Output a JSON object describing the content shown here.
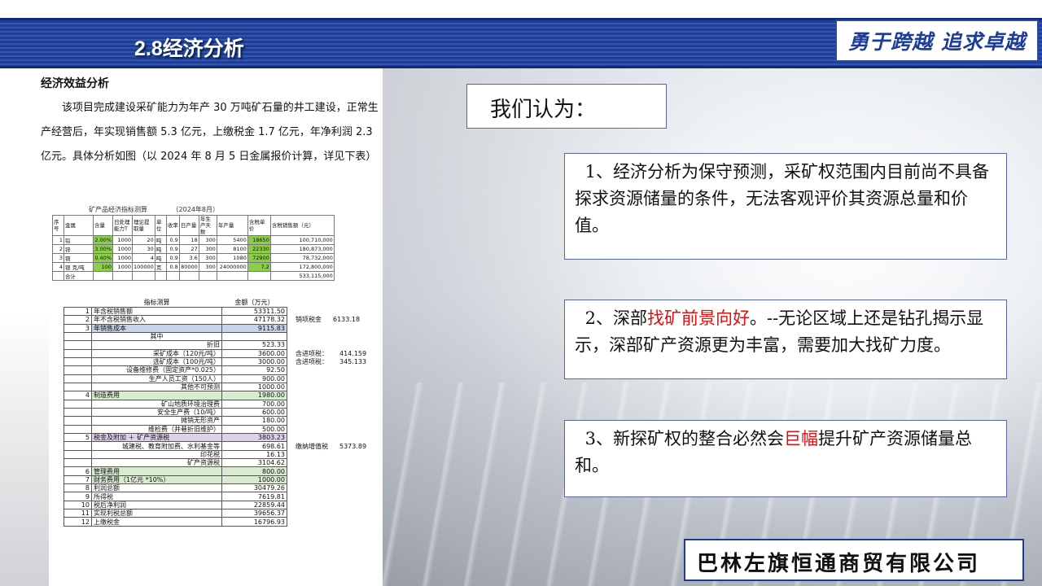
{
  "header": {
    "title": "2.8经济分析",
    "slogan": "勇于跨越  追求卓越"
  },
  "left": {
    "section_title": "经济效益分析",
    "paragraph": "该项目完成建设采矿能力为年产 30 万吨矿石量的井工建设，正常生产经营后，年实现销售额 5.3 亿元，上缴税金 1.7 亿元，年净利润 2.3 亿元。具体分析如图（以 2024 年 8 月 5 日金属报价计算，详见下表）"
  },
  "table1": {
    "caption": "矿产品经济指标测算",
    "date": "（2024年8月）",
    "headers": [
      "序号",
      "金属",
      "含量",
      "日处理能力T",
      "理论提取量",
      "单位",
      "收率",
      "日产量",
      "年生产天数",
      "年产量",
      "含税单价",
      "含税销售额（元）"
    ],
    "rows": [
      [
        "1",
        "铅",
        "2.00%",
        "1000",
        "20",
        "吨",
        "0.9",
        "18",
        "300",
        "5400",
        "18650",
        "100,710,000"
      ],
      [
        "2",
        "锌",
        "3.00%",
        "1000",
        "30",
        "吨",
        "0.9",
        "27",
        "300",
        "8100",
        "22330",
        "180,873,000"
      ],
      [
        "3",
        "铜",
        "0.40%",
        "1000",
        "4",
        "吨",
        "0.9",
        "3.6",
        "300",
        "1080",
        "72900",
        "78,732,000"
      ],
      [
        "4",
        "银 克/吨",
        "100",
        "1000",
        "100000",
        "克",
        "0.8",
        "80000",
        "300",
        "24000000",
        "7.2",
        "172,800,000"
      ]
    ],
    "total_label": "合计",
    "total_value": "533,115,000"
  },
  "table2": {
    "header_item": "指标测算",
    "header_amount": "金额（万元）",
    "rows": [
      {
        "no": "1",
        "item": "年含税销售额",
        "amount": "53311.50",
        "style": "",
        "align": "left",
        "ext_label": "",
        "ext_value": ""
      },
      {
        "no": "2",
        "item": "年不含税销售收入",
        "amount": "47178.32",
        "style": "",
        "align": "left",
        "ext_label": "销项税金",
        "ext_value": "6133.18"
      },
      {
        "no": "3",
        "item": "年销售成本",
        "amount": "9115.83",
        "style": "blue",
        "align": "left",
        "ext_label": "",
        "ext_value": ""
      },
      {
        "no": "",
        "item": "其中",
        "amount": "",
        "style": "",
        "align": "center",
        "ext_label": "",
        "ext_value": ""
      },
      {
        "no": "",
        "item": "折旧",
        "amount": "523.33",
        "style": "",
        "align": "right",
        "ext_label": "",
        "ext_value": ""
      },
      {
        "no": "",
        "item": "采矿成本（120元/吨）",
        "amount": "3600.00",
        "style": "",
        "align": "right",
        "ext_label": "含进项税：",
        "ext_value": "414.159"
      },
      {
        "no": "",
        "item": "选矿成本（100元/吨）",
        "amount": "3000.00",
        "style": "",
        "align": "right",
        "ext_label": "含进项税：",
        "ext_value": "345.133"
      },
      {
        "no": "",
        "item": "设备维修费（固定资产*0.025）",
        "amount": "92.50",
        "style": "",
        "align": "right",
        "ext_label": "",
        "ext_value": ""
      },
      {
        "no": "",
        "item": "生产人员工资（150人）",
        "amount": "900.00",
        "style": "",
        "align": "right",
        "ext_label": "",
        "ext_value": ""
      },
      {
        "no": "",
        "item": "其他不可预测",
        "amount": "1000.00",
        "style": "",
        "align": "right",
        "ext_label": "",
        "ext_value": ""
      },
      {
        "no": "4",
        "item": "制造费用",
        "amount": "1980.00",
        "style": "green",
        "align": "left",
        "ext_label": "",
        "ext_value": ""
      },
      {
        "no": "",
        "item": "矿山地质环境治理费",
        "amount": "700.00",
        "style": "",
        "align": "right",
        "ext_label": "",
        "ext_value": ""
      },
      {
        "no": "",
        "item": "安全生产费（10/吨）",
        "amount": "600.00",
        "style": "",
        "align": "right",
        "ext_label": "",
        "ext_value": ""
      },
      {
        "no": "",
        "item": "摊销无形资产",
        "amount": "180.00",
        "style": "",
        "align": "right",
        "ext_label": "",
        "ext_value": ""
      },
      {
        "no": "",
        "item": "维检费（井巷折旧维护）",
        "amount": "500.00",
        "style": "",
        "align": "right",
        "ext_label": "",
        "ext_value": ""
      },
      {
        "no": "5",
        "item": "税金及附加 ＋ 矿产资源税",
        "amount": "3803.23",
        "style": "purple",
        "align": "left",
        "ext_label": "",
        "ext_value": ""
      },
      {
        "no": "",
        "item": "城建税、教育附加费、水利基金等",
        "amount": "698.61",
        "style": "",
        "align": "right",
        "ext_label": "缴纳增值税",
        "ext_value": "5373.89"
      },
      {
        "no": "",
        "item": "印花税",
        "amount": "16.13",
        "style": "",
        "align": "right",
        "ext_label": "",
        "ext_value": ""
      },
      {
        "no": "",
        "item": "矿产资源税",
        "amount": "3104.62",
        "style": "",
        "align": "right",
        "ext_label": "",
        "ext_value": ""
      },
      {
        "no": "6",
        "item": "管理费用",
        "amount": "800.00",
        "style": "green",
        "align": "left",
        "ext_label": "",
        "ext_value": ""
      },
      {
        "no": "7",
        "item": "财务费用（1亿元 *10%）",
        "amount": "1000.00",
        "style": "green",
        "align": "left",
        "ext_label": "",
        "ext_value": ""
      },
      {
        "no": "8",
        "item": "利润总额",
        "amount": "30479.26",
        "style": "",
        "align": "left",
        "ext_label": "",
        "ext_value": ""
      },
      {
        "no": "9",
        "item": "所得税",
        "amount": "7619.81",
        "style": "",
        "align": "left",
        "ext_label": "",
        "ext_value": ""
      },
      {
        "no": "10",
        "item": "税后净利润",
        "amount": "22859.44",
        "style": "",
        "align": "left",
        "ext_label": "",
        "ext_value": ""
      },
      {
        "no": "11",
        "item": "实现利税总额",
        "amount": "39656.37",
        "style": "",
        "align": "left",
        "ext_label": "",
        "ext_value": ""
      },
      {
        "no": "12",
        "item": "上缴税金",
        "amount": "16796.93",
        "style": "",
        "align": "left",
        "ext_label": "",
        "ext_value": ""
      }
    ]
  },
  "right": {
    "opinion_title": "我们认为：",
    "point1": "1、经济分析为保守预测，采矿权范围内目前尚不具备探求资源储量的条件，无法客观评价其资源总量和价值。",
    "point2_a": "2、深部",
    "point2_red": "找矿前景向好",
    "point2_b": "。--无论区域上还是钻孔揭示显示，深部矿产资源更为丰富，需要加大找矿力度。",
    "point3_a": "3、新探矿权的整合必然会",
    "point3_red": "巨幅",
    "point3_b": "提升矿产资源储量总和。",
    "company": "巴林左旗恒通商贸有限公司"
  },
  "colors": {
    "header_blue": "#1f3f94",
    "accent_red": "#e01010",
    "highlight_green": "#8ccd4b"
  }
}
